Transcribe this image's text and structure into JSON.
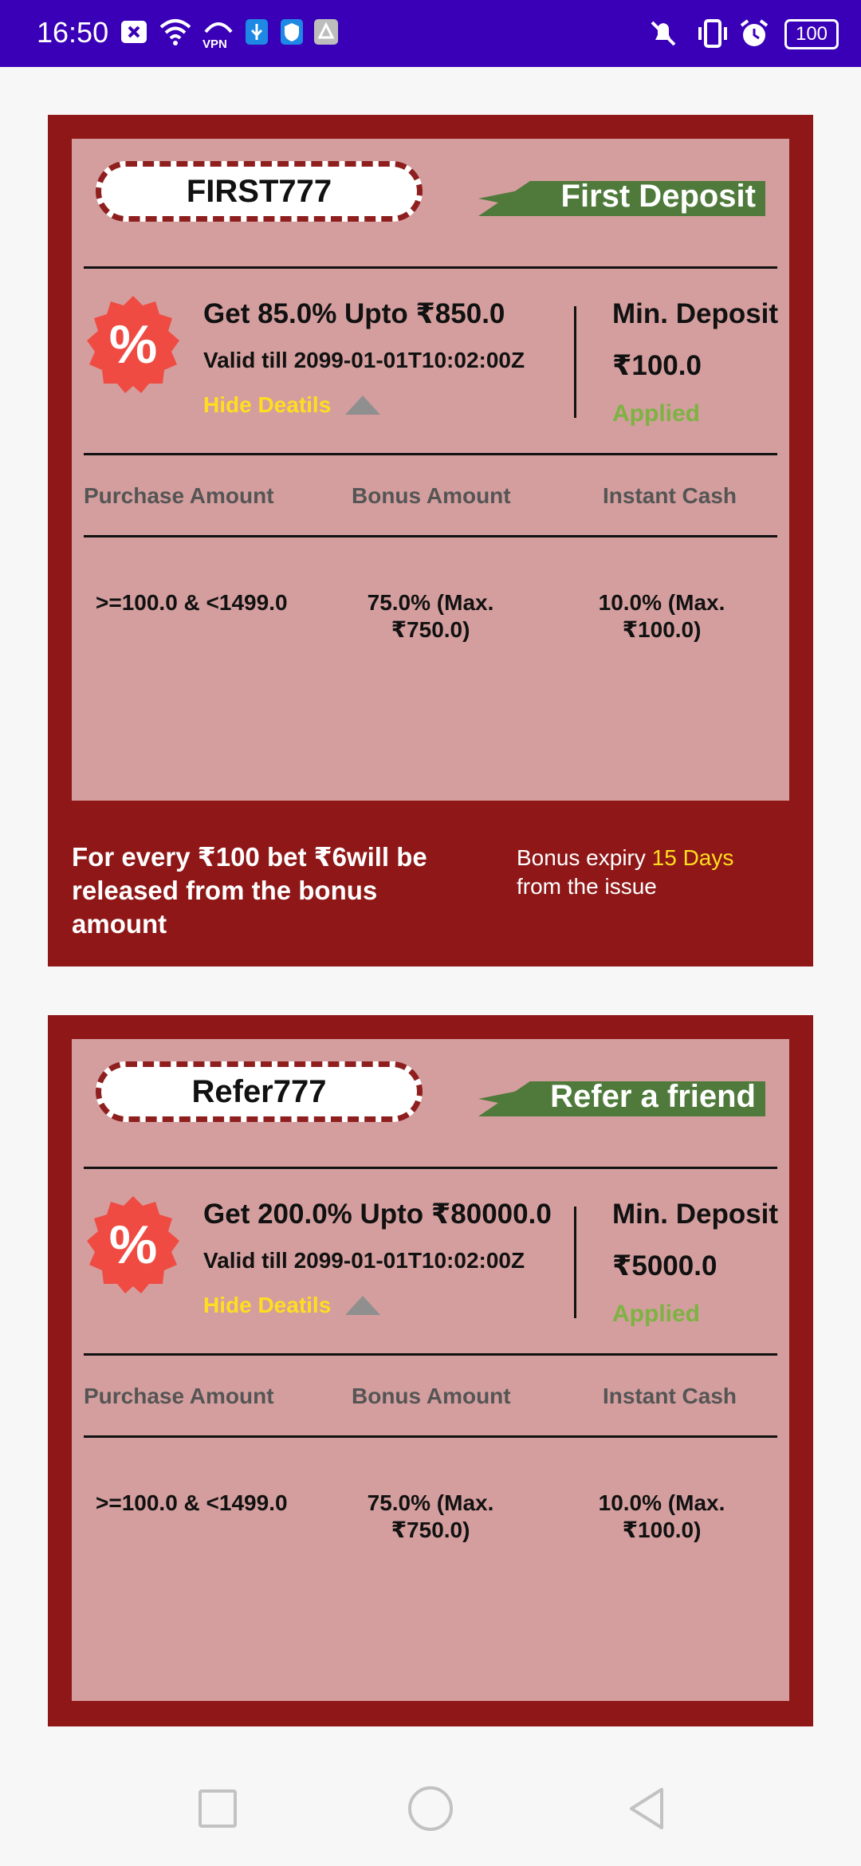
{
  "status_bar": {
    "time": "16:50",
    "battery": "100",
    "icons": [
      "close-box-icon",
      "wifi-icon",
      "vpn-icon",
      "usb-icon",
      "shield-icon",
      "app-icon",
      "mute-icon",
      "vibrate-icon",
      "alarm-icon",
      "battery-icon"
    ]
  },
  "coupons": [
    {
      "code": "FIRST777",
      "type": "First Deposit",
      "offer": "Get 85.0% Upto ₹850.0",
      "valid": "Valid till 2099-01-01T10:02:00Z",
      "hide_details": "Hide Deatils",
      "min_deposit_label": "Min. Deposit",
      "min_deposit_value": "₹100.0",
      "status": "Applied",
      "table": {
        "headers": [
          "Purchase Amount",
          "Bonus Amount",
          "Instant Cash"
        ],
        "rows": [
          [
            ">=100.0 & <1499.0",
            "75.0% (Max.\n₹750.0)",
            "10.0% (Max.\n₹100.0)"
          ]
        ]
      },
      "footer_left": "For every ₹100 bet ₹6will be released from the  bonus amount",
      "footer_right_prefix": "Bonus expiry ",
      "footer_right_days": "15 Days",
      "footer_right_suffix": "from the issue"
    },
    {
      "code": "Refer777",
      "type": "Refer a friend",
      "offer": "Get 200.0% Upto ₹80000.0",
      "valid": "Valid till 2099-01-01T10:02:00Z",
      "hide_details": "Hide Deatils",
      "min_deposit_label": "Min. Deposit",
      "min_deposit_value": "₹5000.0",
      "status": "Applied",
      "table": {
        "headers": [
          "Purchase Amount",
          "Bonus Amount",
          "Instant Cash"
        ],
        "rows": [
          [
            ">=100.0 & <1499.0",
            "75.0% (Max.\n₹750.0)",
            "10.0% (Max.\n₹100.0)"
          ]
        ]
      }
    }
  ],
  "colors": {
    "status_bar": "#3a00b8",
    "card_outer": "#8f1717",
    "card_inner": "#d49e9e",
    "ribbon": "#4f7a3b",
    "applied": "#7cb342",
    "link": "#ffde1f"
  },
  "nav": {
    "icons": [
      "recents-icon",
      "home-icon",
      "back-icon"
    ]
  }
}
